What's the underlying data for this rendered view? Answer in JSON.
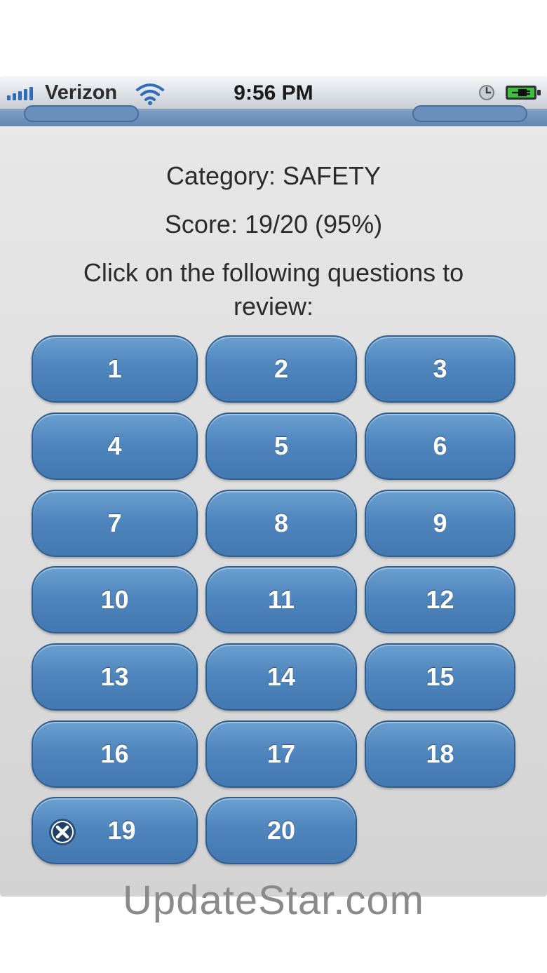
{
  "status_bar": {
    "carrier": "Verizon",
    "time": "9:56 PM",
    "icons": [
      "signal-bars-icon",
      "wifi-icon",
      "clock-icon",
      "battery-charging-icon"
    ]
  },
  "summary": {
    "category": "Category: SAFETY",
    "score": "Score: 19/20 (95%)",
    "instruction_line1": "Click on the following questions to",
    "instruction_line2": "review:"
  },
  "questions": [
    {
      "label": "1"
    },
    {
      "label": "2"
    },
    {
      "label": "3"
    },
    {
      "label": "4"
    },
    {
      "label": "5"
    },
    {
      "label": "6"
    },
    {
      "label": "7"
    },
    {
      "label": "8"
    },
    {
      "label": "9"
    },
    {
      "label": "10"
    },
    {
      "label": "11"
    },
    {
      "label": "12"
    },
    {
      "label": "13"
    },
    {
      "label": "14"
    },
    {
      "label": "15"
    },
    {
      "label": "16"
    },
    {
      "label": "17"
    },
    {
      "label": "18"
    },
    {
      "label": "19",
      "incorrect": true,
      "icon": "x-circle-icon"
    },
    {
      "label": "20"
    }
  ],
  "colors": {
    "button_top": "#6b9fd0",
    "button_bottom": "#4378b0",
    "button_border": "#2f5f8f",
    "nav_bar": "#6186b4"
  },
  "watermark": "UpdateStar.com"
}
